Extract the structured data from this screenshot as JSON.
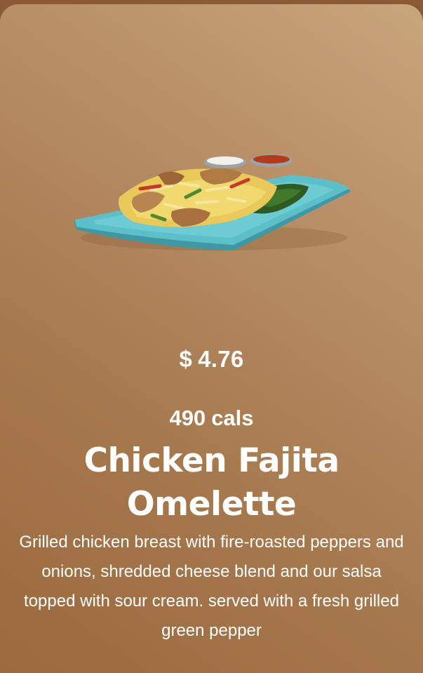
{
  "item": {
    "image_alt": "Chicken Fajita Omelette on a blue platter with sides of salsa and sour cream",
    "price_symbol": "$",
    "price_value": "4.76",
    "calories_value": "490",
    "calories_unit": "cals",
    "name": "Chicken Fajita Omelette",
    "description": "Grilled chicken breast with fire-roasted peppers and onions, shredded cheese blend and our salsa topped with sour cream. served with a fresh grilled green pepper"
  },
  "colors": {
    "card_top": "#c9a57c",
    "card_bottom": "#9b6a3f",
    "text": "#ffffff",
    "plate": "#4fb3bd"
  }
}
